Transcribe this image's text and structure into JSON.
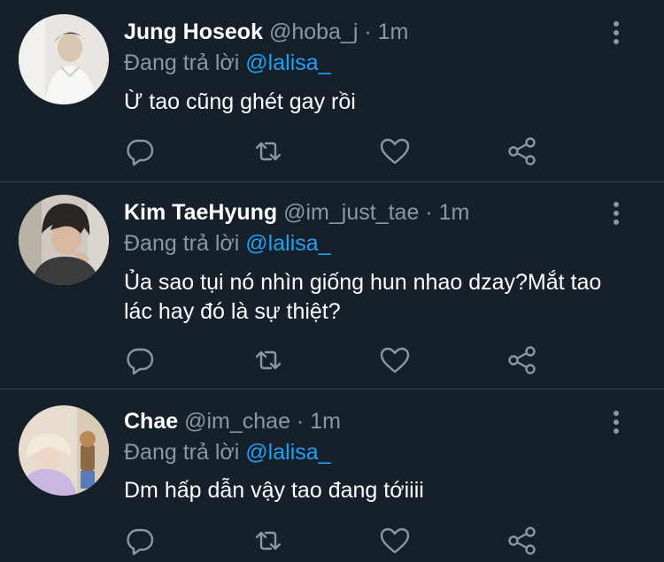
{
  "tweets": [
    {
      "name": "Jung Hoseok",
      "handle": "@hoba_j",
      "separator": "·",
      "time": "1m",
      "replying_prefix": "Đang trả lời",
      "replying_to": "@lalisa_",
      "text": "Ừ tao cũng ghét gay rồi"
    },
    {
      "name": "Kim TaeHyung",
      "handle": "@im_just_tae",
      "separator": "·",
      "time": "1m",
      "replying_prefix": "Đang trả lời",
      "replying_to": "@lalisa_",
      "text": "Ủa sao tụi nó nhìn giống hun nhao dzay?Mắt tao lác hay đó là sự thiệt?"
    },
    {
      "name": "Chae",
      "handle": "@im_chae",
      "separator": "·",
      "time": "1m",
      "replying_prefix": "Đang trả lời",
      "replying_to": "@lalisa_",
      "text": "Dm hấp dẫn vậy tao đang tớiiii"
    }
  ],
  "icons": {
    "reply": "reply-icon",
    "retweet": "retweet-icon",
    "like": "like-icon",
    "share": "share-icon",
    "more": "more-options-icon"
  },
  "colors": {
    "background": "#15202b",
    "divider": "#38444d",
    "secondary_text": "#8899a6",
    "mention": "#1da1f2"
  }
}
